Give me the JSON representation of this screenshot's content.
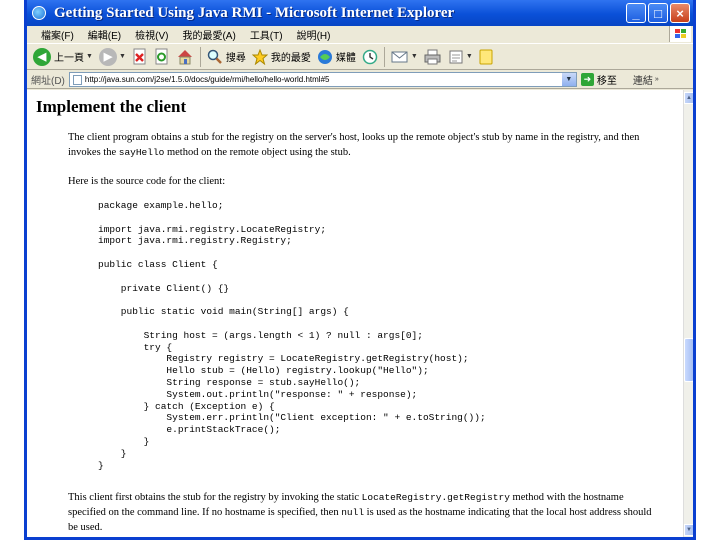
{
  "window": {
    "title": "Getting Started Using Java RMI - Microsoft Internet Explorer",
    "controls": {
      "minimize": "_",
      "maximize": "□",
      "close": "×"
    }
  },
  "menu": {
    "items": [
      "檔案(F)",
      "編輯(E)",
      "檢視(V)",
      "我的最愛(A)",
      "工具(T)",
      "說明(H)"
    ]
  },
  "toolbar": {
    "back": "上一頁",
    "search": "搜尋",
    "favorites": "我的最愛",
    "media": "媒體"
  },
  "address": {
    "label": "網址(D)",
    "url": "http://java.sun.com/j2se/1.5.0/docs/guide/rmi/hello/hello-world.html#5",
    "go": "移至",
    "links": "連結"
  },
  "page": {
    "heading": "Implement the client",
    "intro": {
      "before": "The client program obtains a stub for the registry on the server's host, looks up the remote object's stub by name in the registry, and then invokes the ",
      "code": "sayHello",
      "after": " method on the remote object using the stub."
    },
    "source_intro": "Here is the source code for the client:",
    "code": "package example.hello;\n\nimport java.rmi.registry.LocateRegistry;\nimport java.rmi.registry.Registry;\n\npublic class Client {\n\n    private Client() {}\n\n    public static void main(String[] args) {\n\n        String host = (args.length < 1) ? null : args[0];\n        try {\n            Registry registry = LocateRegistry.getRegistry(host);\n            Hello stub = (Hello) registry.lookup(\"Hello\");\n            String response = stub.sayHello();\n            System.out.println(\"response: \" + response);\n        } catch (Exception e) {\n            System.err.println(\"Client exception: \" + e.toString());\n            e.printStackTrace();\n        }\n    }\n}",
    "outro": {
      "before": "This client first obtains the stub for the registry by invoking the static ",
      "code1": "LocateRegistry.getRegistry",
      "middle": " method with the hostname specified on the command line. If no hostname is specified, then ",
      "code2": "null",
      "after": " is used as the hostname indicating that the local host address should be used."
    }
  },
  "colors": {
    "titlebar": "#0a50d8",
    "chrome": "#ece9d8",
    "page_bg": "#ffffff"
  }
}
